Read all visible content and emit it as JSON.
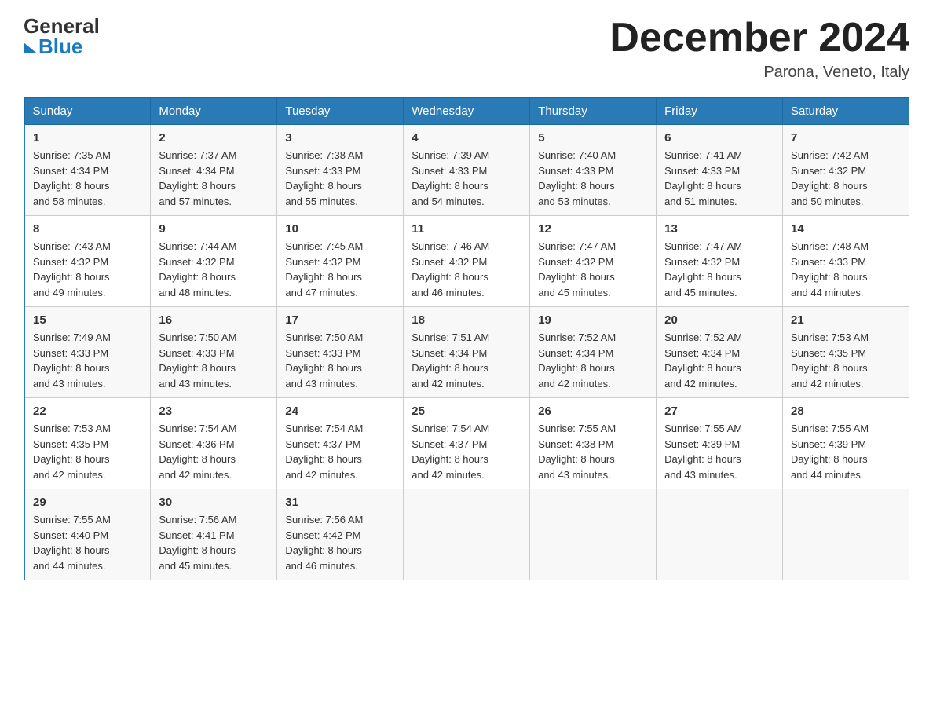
{
  "header": {
    "logo_general": "General",
    "logo_blue": "Blue",
    "month_title": "December 2024",
    "location": "Parona, Veneto, Italy"
  },
  "days_of_week": [
    "Sunday",
    "Monday",
    "Tuesday",
    "Wednesday",
    "Thursday",
    "Friday",
    "Saturday"
  ],
  "weeks": [
    [
      {
        "day": "1",
        "sunrise": "7:35 AM",
        "sunset": "4:34 PM",
        "daylight": "8 hours and 58 minutes."
      },
      {
        "day": "2",
        "sunrise": "7:37 AM",
        "sunset": "4:34 PM",
        "daylight": "8 hours and 57 minutes."
      },
      {
        "day": "3",
        "sunrise": "7:38 AM",
        "sunset": "4:33 PM",
        "daylight": "8 hours and 55 minutes."
      },
      {
        "day": "4",
        "sunrise": "7:39 AM",
        "sunset": "4:33 PM",
        "daylight": "8 hours and 54 minutes."
      },
      {
        "day": "5",
        "sunrise": "7:40 AM",
        "sunset": "4:33 PM",
        "daylight": "8 hours and 53 minutes."
      },
      {
        "day": "6",
        "sunrise": "7:41 AM",
        "sunset": "4:33 PM",
        "daylight": "8 hours and 51 minutes."
      },
      {
        "day": "7",
        "sunrise": "7:42 AM",
        "sunset": "4:32 PM",
        "daylight": "8 hours and 50 minutes."
      }
    ],
    [
      {
        "day": "8",
        "sunrise": "7:43 AM",
        "sunset": "4:32 PM",
        "daylight": "8 hours and 49 minutes."
      },
      {
        "day": "9",
        "sunrise": "7:44 AM",
        "sunset": "4:32 PM",
        "daylight": "8 hours and 48 minutes."
      },
      {
        "day": "10",
        "sunrise": "7:45 AM",
        "sunset": "4:32 PM",
        "daylight": "8 hours and 47 minutes."
      },
      {
        "day": "11",
        "sunrise": "7:46 AM",
        "sunset": "4:32 PM",
        "daylight": "8 hours and 46 minutes."
      },
      {
        "day": "12",
        "sunrise": "7:47 AM",
        "sunset": "4:32 PM",
        "daylight": "8 hours and 45 minutes."
      },
      {
        "day": "13",
        "sunrise": "7:47 AM",
        "sunset": "4:32 PM",
        "daylight": "8 hours and 45 minutes."
      },
      {
        "day": "14",
        "sunrise": "7:48 AM",
        "sunset": "4:33 PM",
        "daylight": "8 hours and 44 minutes."
      }
    ],
    [
      {
        "day": "15",
        "sunrise": "7:49 AM",
        "sunset": "4:33 PM",
        "daylight": "8 hours and 43 minutes."
      },
      {
        "day": "16",
        "sunrise": "7:50 AM",
        "sunset": "4:33 PM",
        "daylight": "8 hours and 43 minutes."
      },
      {
        "day": "17",
        "sunrise": "7:50 AM",
        "sunset": "4:33 PM",
        "daylight": "8 hours and 43 minutes."
      },
      {
        "day": "18",
        "sunrise": "7:51 AM",
        "sunset": "4:34 PM",
        "daylight": "8 hours and 42 minutes."
      },
      {
        "day": "19",
        "sunrise": "7:52 AM",
        "sunset": "4:34 PM",
        "daylight": "8 hours and 42 minutes."
      },
      {
        "day": "20",
        "sunrise": "7:52 AM",
        "sunset": "4:34 PM",
        "daylight": "8 hours and 42 minutes."
      },
      {
        "day": "21",
        "sunrise": "7:53 AM",
        "sunset": "4:35 PM",
        "daylight": "8 hours and 42 minutes."
      }
    ],
    [
      {
        "day": "22",
        "sunrise": "7:53 AM",
        "sunset": "4:35 PM",
        "daylight": "8 hours and 42 minutes."
      },
      {
        "day": "23",
        "sunrise": "7:54 AM",
        "sunset": "4:36 PM",
        "daylight": "8 hours and 42 minutes."
      },
      {
        "day": "24",
        "sunrise": "7:54 AM",
        "sunset": "4:37 PM",
        "daylight": "8 hours and 42 minutes."
      },
      {
        "day": "25",
        "sunrise": "7:54 AM",
        "sunset": "4:37 PM",
        "daylight": "8 hours and 42 minutes."
      },
      {
        "day": "26",
        "sunrise": "7:55 AM",
        "sunset": "4:38 PM",
        "daylight": "8 hours and 43 minutes."
      },
      {
        "day": "27",
        "sunrise": "7:55 AM",
        "sunset": "4:39 PM",
        "daylight": "8 hours and 43 minutes."
      },
      {
        "day": "28",
        "sunrise": "7:55 AM",
        "sunset": "4:39 PM",
        "daylight": "8 hours and 44 minutes."
      }
    ],
    [
      {
        "day": "29",
        "sunrise": "7:55 AM",
        "sunset": "4:40 PM",
        "daylight": "8 hours and 44 minutes."
      },
      {
        "day": "30",
        "sunrise": "7:56 AM",
        "sunset": "4:41 PM",
        "daylight": "8 hours and 45 minutes."
      },
      {
        "day": "31",
        "sunrise": "7:56 AM",
        "sunset": "4:42 PM",
        "daylight": "8 hours and 46 minutes."
      },
      null,
      null,
      null,
      null
    ]
  ],
  "labels": {
    "sunrise": "Sunrise:",
    "sunset": "Sunset:",
    "daylight": "Daylight:"
  }
}
